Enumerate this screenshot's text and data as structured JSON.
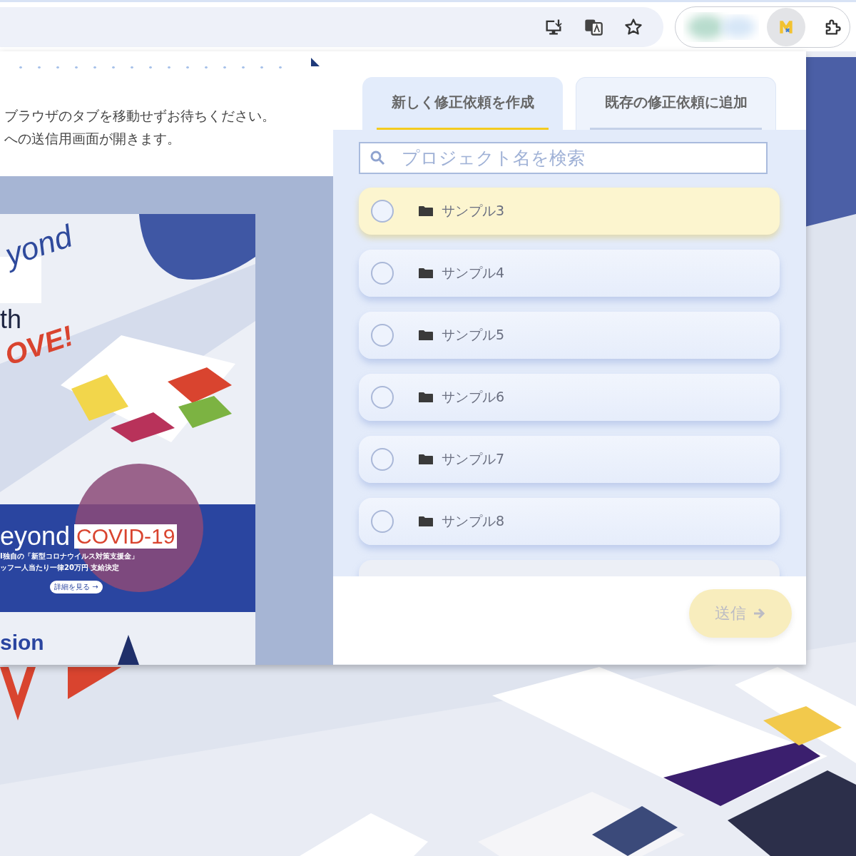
{
  "notice": {
    "lines": [
      "ブラウザのタブを移動せずお待ちください。",
      "への送信用画面が開きます。"
    ]
  },
  "preview": {
    "hero_lines": [
      {
        "kind": "blue",
        "text": "yond"
      },
      {
        "kind": "dark",
        "text": "th"
      },
      {
        "kind": "red",
        "text": "OVE!"
      }
    ],
    "banner": {
      "title": "eyond",
      "badge": "COVID-19",
      "lines": [
        "I独自の「新型コロナウイルス対策支援金」",
        "ッフー人当たり一律20万円 支給決定"
      ],
      "button": "詳細を見る →"
    },
    "section_title": "sion"
  },
  "tabs": [
    {
      "label": "新しく修正依頼を作成",
      "selected": true
    },
    {
      "label": "既存の修正依頼に追加",
      "selected": false
    }
  ],
  "search": {
    "placeholder": "プロジェクト名を検索"
  },
  "projects": [
    {
      "name": "サンプル3",
      "selected": true
    },
    {
      "name": "サンプル4",
      "selected": false
    },
    {
      "name": "サンプル5",
      "selected": false
    },
    {
      "name": "サンプル6",
      "selected": false
    },
    {
      "name": "サンプル7",
      "selected": false
    },
    {
      "name": "サンプル8",
      "selected": false
    }
  ],
  "submit": {
    "label": "送信",
    "disabled": true
  }
}
